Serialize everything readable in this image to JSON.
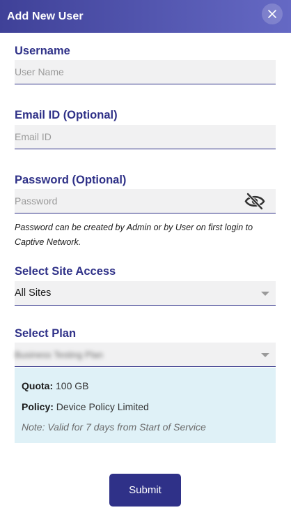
{
  "header": {
    "title": "Add New User",
    "close_icon": "close-icon"
  },
  "username": {
    "label": "Username",
    "placeholder": "User Name",
    "value": ""
  },
  "email": {
    "label": "Email ID (Optional)",
    "placeholder": "Email ID",
    "value": ""
  },
  "password": {
    "label": "Password (Optional)",
    "placeholder": "Password",
    "value": "",
    "visibility_icon": "eye-off-icon",
    "note": "Password can be created by Admin or by User on first login to Captive Network."
  },
  "site_access": {
    "label": "Select Site Access",
    "value": "All Sites"
  },
  "plan": {
    "label": "Select Plan",
    "value": "Business Testing Plan",
    "quota_label": "Quota:",
    "quota_value": "100 GB",
    "policy_label": "Policy:",
    "policy_value": "Device Policy Limited",
    "note": "Note: Valid for 7 days from Start of Service"
  },
  "submit_label": "Submit",
  "colors": {
    "primary": "#2f3188",
    "header_start": "#3f4198",
    "header_end": "#6569c4",
    "field_bg": "#f1f1f2",
    "plan_box_bg": "#dff1f7"
  }
}
